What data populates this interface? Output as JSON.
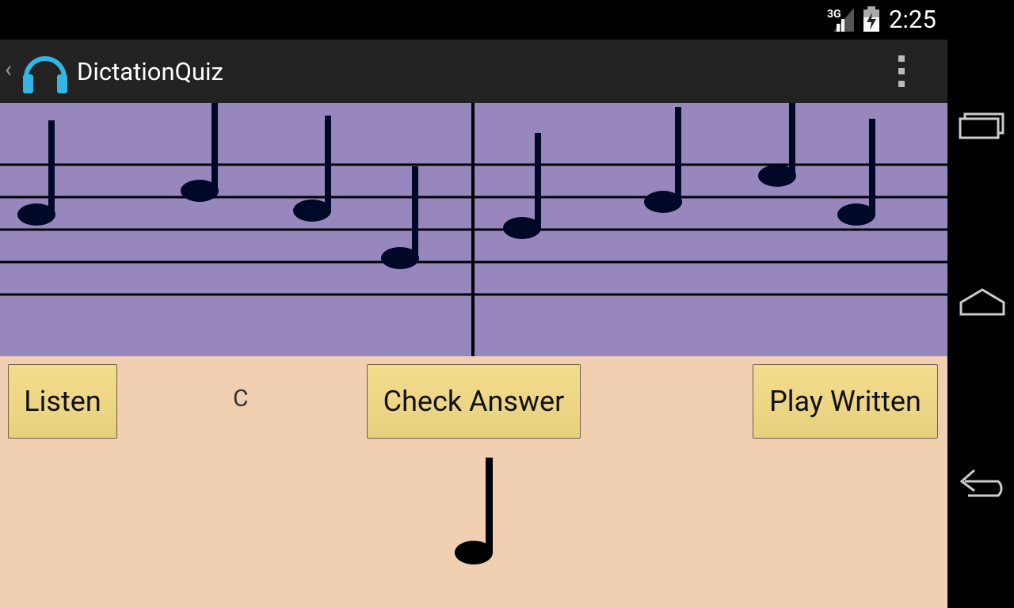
{
  "status_bar": {
    "network": "3G",
    "time": "2:25"
  },
  "action_bar": {
    "title": "DictationQuiz"
  },
  "controls": {
    "listen_label": "Listen",
    "note_name": "C",
    "check_label": "Check Answer",
    "play_label": "Play Written"
  },
  "colors": {
    "staff_background": "#9787bd",
    "panel_background": "#f0d0b0",
    "button_background": "#f0d888",
    "app_icon": "#33b5e5"
  },
  "icons": [
    "app-headphones-icon",
    "overflow-menu-icon",
    "recent-apps-icon",
    "home-icon",
    "back-icon",
    "signal-icon",
    "battery-icon"
  ]
}
